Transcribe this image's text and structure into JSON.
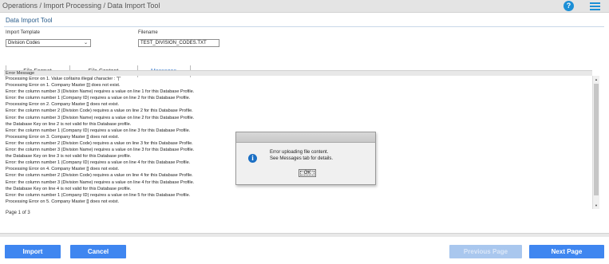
{
  "breadcrumb": "Operations / Import Processing / Data Import Tool",
  "panel_title": "Data Import Tool",
  "form": {
    "import_template_label": "Import Template",
    "import_template_value": "Division Codes",
    "filename_label": "Filename",
    "filename_value": "TEST_DIVISION_CODES.TXT"
  },
  "tabs": [
    {
      "label": "File Format"
    },
    {
      "label": "File Content"
    },
    {
      "label": "Messages"
    }
  ],
  "grid": {
    "column_header": "Error Message",
    "messages": [
      "Processing Error on 1. Value contains illegal character : \"|\"",
      "Processing Error on 1. Company Master [|] does not exist.",
      "Error: the column number 3 (Division Name) requires a value on line 1 for this Database Profile.",
      "Error: the column number 1 (Company ID) requires a value on line 2 for this Database Profile.",
      "Processing Error on 2. Company Master [] does not exist.",
      "Error: the column number 2 (Division Code) requires a value on line 2 for this Database Profile.",
      "Error: the column number 3 (Division Name) requires a value on line 2 for this Database Profile.",
      "the Database Key on line 2 is not valid for this Database profile.",
      "Error: the column number 1 (Company ID) requires a value on line 3 for this Database Profile.",
      "Processing Error on 3. Company Master [] does not exist.",
      "Error: the column number 2 (Division Code) requires a value on line 3 for this Database Profile.",
      "Error: the column number 3 (Division Name) requires a value on line 3 for this Database Profile.",
      "the Database Key on line 3 is not valid for this Database profile.",
      "Error: the column number 1 (Company ID) requires a value on line 4 for this Database Profile.",
      "Processing Error on 4. Company Master [] does not exist.",
      "Error: the column number 2 (Division Code) requires a value on line 4 for this Database Profile.",
      "Error: the column number 3 (Division Name) requires a value on line 4 for this Database Profile.",
      "the Database Key on line 4 is not valid for this Database profile.",
      "Error: the column number 1 (Company ID) requires a value on line 5 for this Database Profile.",
      "Processing Error on 5. Company Master [] does not exist."
    ]
  },
  "pagination": "Page 1 of 3",
  "dialog": {
    "line1": "Error uploading file content.",
    "line2": "See Messages tab for details.",
    "ok_label": "OK"
  },
  "buttons": {
    "import": "Import",
    "cancel": "Cancel",
    "previous_page": "Previous Page",
    "next_page": "Next Page"
  },
  "icons": {
    "help": "help-icon",
    "menu": "hamburger-menu-icon",
    "info": "info-icon"
  },
  "colors": {
    "accent": "#3f86f0",
    "help_icon": "#1c8fd6",
    "active_tab": "#3d7cc9"
  }
}
